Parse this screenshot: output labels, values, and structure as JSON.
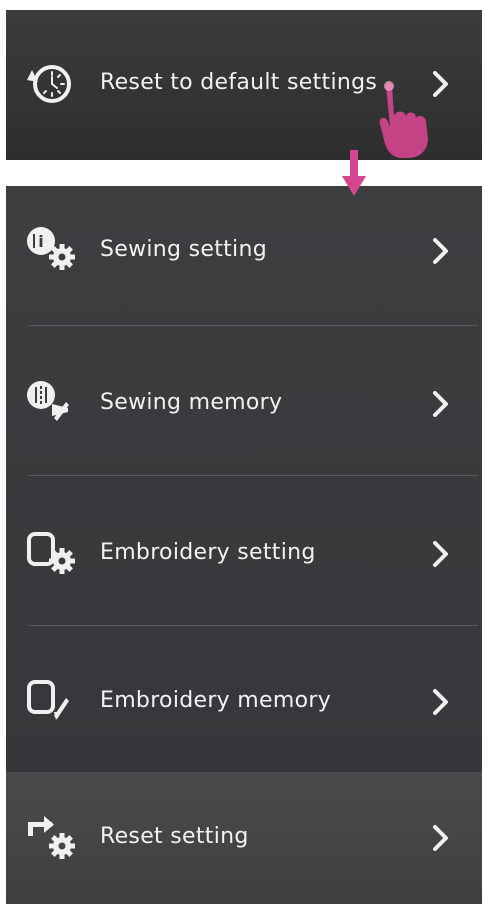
{
  "menu": {
    "reset_default": {
      "label": "Reset to default settings",
      "icon": "reset-clock-icon"
    },
    "items": [
      {
        "label": "Sewing setting",
        "icon": "sewing-setting-icon"
      },
      {
        "label": "Sewing memory",
        "icon": "sewing-memory-icon"
      },
      {
        "label": "Embroidery setting",
        "icon": "embroidery-setting-icon"
      },
      {
        "label": "Embroidery memory",
        "icon": "embroidery-memory-icon"
      }
    ],
    "reset_setting": {
      "label": "Reset setting",
      "icon": "reset-setting-icon"
    }
  },
  "colors": {
    "panel_dark": "#333333",
    "panel_mid": "#3a3b3d",
    "panel_highlight": "#454648",
    "text": "#f2f2f2",
    "annotation_pink": "#d4468f"
  }
}
